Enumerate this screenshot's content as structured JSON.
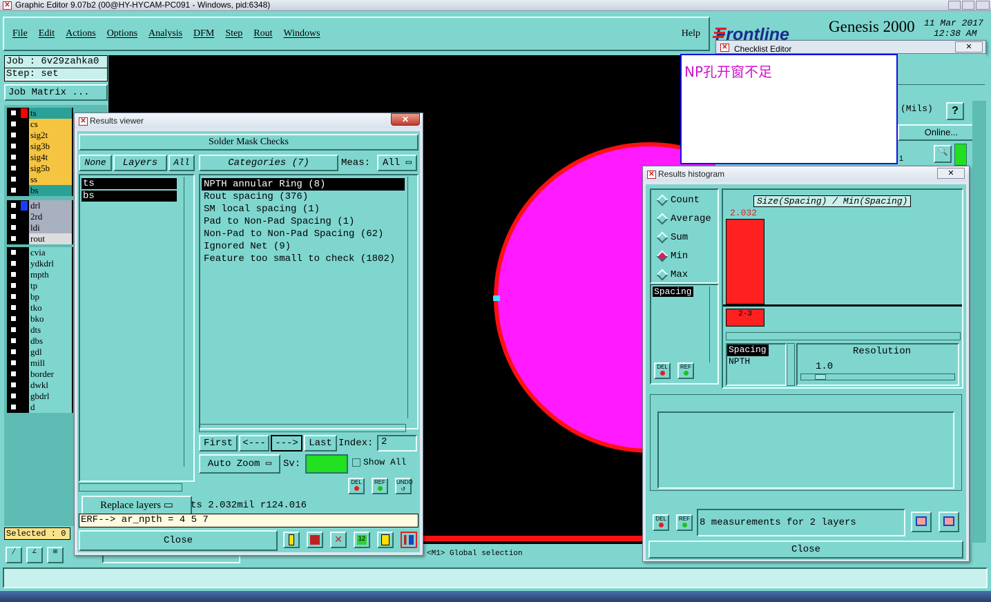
{
  "window_title": "Graphic Editor 9.07b2 (00@HY-HYCAM-PC091 - Windows, pid:6348)",
  "menu": {
    "items": [
      "File",
      "Edit",
      "Actions",
      "Options",
      "Analysis",
      "DFM",
      "Step",
      "Rout",
      "Windows"
    ],
    "help": "Help"
  },
  "brand": {
    "logo": "Frontline",
    "product": "Genesis 2000",
    "date": "11 Mar 2017",
    "time": "12:38 AM"
  },
  "job": {
    "job_label": "Job : 6v29zahka0",
    "step_label": "Step: set",
    "matrix_button": "Job Matrix ..."
  },
  "layers": [
    {
      "name": "ts",
      "color": "#2aa198",
      "flag": "#ff0000"
    },
    {
      "name": "cs",
      "color": "#f5c542"
    },
    {
      "name": "sig2t",
      "color": "#f5c542"
    },
    {
      "name": "sig3b",
      "color": "#f5c542"
    },
    {
      "name": "sig4t",
      "color": "#f5c542"
    },
    {
      "name": "sig5b",
      "color": "#f5c542"
    },
    {
      "name": "ss",
      "color": "#f5c542"
    },
    {
      "name": "bs",
      "color": "#2aa198"
    }
  ],
  "drill_layers": [
    {
      "name": "drl",
      "color": "#a9b0c0",
      "flag": "#1a3cff"
    },
    {
      "name": "2rd",
      "color": "#a9b0c0"
    },
    {
      "name": "ldi",
      "color": "#a9b0c0"
    },
    {
      "name": "rout",
      "color": "#dddddd"
    }
  ],
  "misc_layers": [
    "cvia",
    "ydkdrl",
    "mpth",
    "tp",
    "bp",
    "tko",
    "bko",
    "dts",
    "dbs",
    "gdl",
    "mill",
    "border",
    "dwkl",
    "gbdrl",
    "d"
  ],
  "selected_status": "Selected : 0",
  "checklist": {
    "title": "Checklist Editor",
    "units": "(Mils)",
    "help": "?",
    "online": "Online...",
    "num": "1"
  },
  "popup_text": "NP孔开窗不足",
  "results_viewer": {
    "title": "Results viewer",
    "header": "Solder Mask Checks",
    "none_btn": "None",
    "layers_btn": "Layers",
    "all_btn": "All",
    "categories_btn": "Categories (7)",
    "meas_label": "Meas:",
    "meas_value": "All",
    "layer_list": [
      "ts",
      "bs"
    ],
    "categories": [
      "NPTH annular Ring (8)",
      "Rout spacing (376)",
      "SM local spacing (1)",
      "Pad to Non-Pad Spacing (1)",
      "Non-Pad to Non-Pad Spacing (62)",
      "Ignored Net (9)",
      "Feature too small to check (1802)"
    ],
    "first": "First",
    "prev": "<---",
    "next": "--->",
    "last": "Last",
    "index_label": "Index:",
    "index_value": "2",
    "auto_zoom": "Auto Zoom",
    "sv_label": "Sv:",
    "show_all": "Show All",
    "replace_layers": "Replace layers",
    "status": "ts 2.032mil  r124.016",
    "erf": "ERF--> ar_npth = 4 5 7",
    "close": "Close",
    "del": "DEL",
    "ref": "REF",
    "undo": "UNDO"
  },
  "histogram": {
    "title": "Results histogram",
    "modes": [
      "Count",
      "Average",
      "Sum",
      "Min",
      "Max"
    ],
    "selected_mode": "Min",
    "axis_title": "Size(Spacing) / Min(Spacing)",
    "bar_value": "2.032",
    "bar_label": "2-3",
    "list_item": "Spacing",
    "spacing_list": [
      "Spacing",
      "NPTH"
    ],
    "resolution_label": "Resolution",
    "resolution_value": "1.0",
    "status": "8 measurements for 2 layers",
    "close": "Close"
  },
  "bottom_prompt": "<M1> Global selection",
  "colors": {
    "canvas": "#000000",
    "pad": "#ff1aff",
    "pad_outline": "#ff1010",
    "bg": "#7fd6cf"
  }
}
